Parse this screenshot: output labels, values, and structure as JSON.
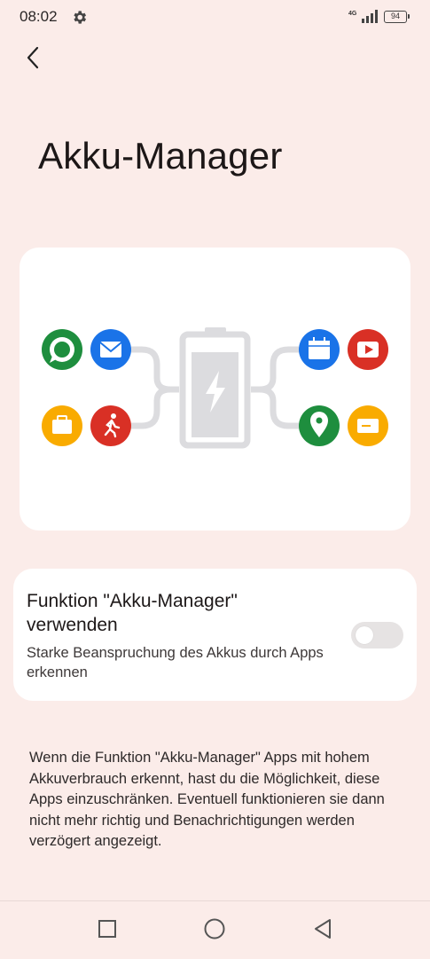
{
  "status_bar": {
    "time": "08:02",
    "network": "4G",
    "battery": "94",
    "icons": [
      "gear-icon",
      "signal-icon",
      "battery-icon"
    ]
  },
  "header": {
    "back_icon": "chevron-left-icon",
    "title": "Akku-Manager"
  },
  "illustration": {
    "battery_color": "#dcdcdf",
    "left_apps": [
      {
        "icon": "message-icon",
        "color": "#1e8e3e"
      },
      {
        "icon": "mail-icon",
        "color": "#1a73e8"
      },
      {
        "icon": "briefcase-icon",
        "color": "#f9ab00"
      },
      {
        "icon": "running-icon",
        "color": "#d93025"
      }
    ],
    "right_apps": [
      {
        "icon": "calendar-icon",
        "color": "#1a73e8"
      },
      {
        "icon": "video-icon",
        "color": "#d93025"
      },
      {
        "icon": "location-icon",
        "color": "#1e8e3e"
      },
      {
        "icon": "ticket-icon",
        "color": "#f9ab00"
      }
    ]
  },
  "setting": {
    "title": "Funktion \"Akku-Manager\" verwenden",
    "subtitle": "Starke Beanspruchung des Akkus durch Apps erkennen",
    "toggle_on": false
  },
  "description": "Wenn die Funktion \"Akku-Manager\" Apps mit hohem Akkuverbrauch erkennt, hast du die Möglichkeit, diese Apps einzuschränken. Eventuell funktionieren sie dann nicht mehr richtig und Benachrichtigungen werden verzögert angezeigt.",
  "nav_bar": {
    "buttons": [
      "recent-apps-icon",
      "home-icon",
      "back-triangle-icon"
    ]
  }
}
